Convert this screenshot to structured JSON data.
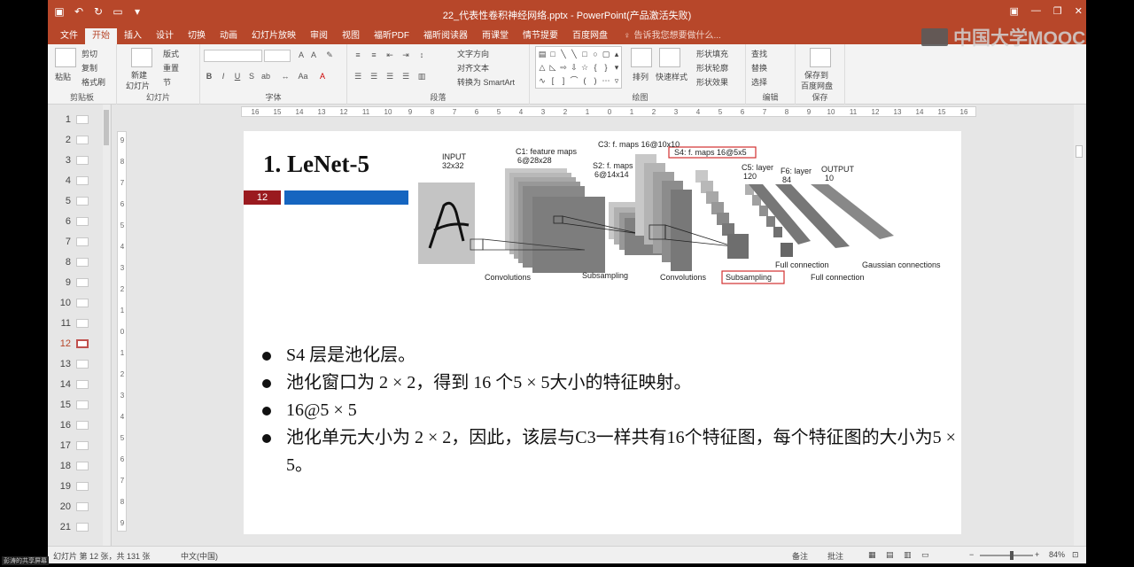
{
  "window": {
    "title": "22_代表性卷积神经网络.pptx - PowerPoint(产品激活失败)"
  },
  "tabs": [
    "文件",
    "开始",
    "插入",
    "设计",
    "切换",
    "动画",
    "幻灯片放映",
    "审阅",
    "视图",
    "福昕PDF",
    "福昕阅读器",
    "雨课堂",
    "情节提要",
    "百度网盘"
  ],
  "active_tab_index": 1,
  "tell_me": "告诉我您想要做什么...",
  "ribbon": {
    "groups": {
      "clipboard": "剪贴板",
      "slides": "幻灯片",
      "font": "字体",
      "paragraph": "段落",
      "drawing": "绘图",
      "editing": "编辑",
      "save": "保存"
    },
    "clipboard": {
      "paste": "粘贴",
      "cut": "剪切",
      "copy": "复制",
      "format_painter": "格式刷"
    },
    "slides": {
      "new_slide": "新建",
      "new_slide_2": "幻灯片",
      "layout": "版式",
      "reset": "重置",
      "section": "节"
    },
    "paragraph": {
      "text_direction": "文字方向",
      "align_text": "对齐文本",
      "smartart": "转换为 SmartArt"
    },
    "drawing": {
      "arrange": "排列",
      "quick_styles": "快速样式",
      "shape_fill": "形状填充",
      "shape_outline": "形状轮廓",
      "shape_effects": "形状效果"
    },
    "editing": {
      "find": "查找",
      "replace": "替换",
      "select": "选择"
    },
    "save": {
      "label1": "保存到",
      "label2": "百度网盘"
    }
  },
  "thumbnails": [
    "1",
    "2",
    "3",
    "4",
    "5",
    "6",
    "7",
    "8",
    "9",
    "10",
    "11",
    "12",
    "13",
    "14",
    "15",
    "16",
    "17",
    "18",
    "19",
    "20",
    "21"
  ],
  "active_thumbnail": "12",
  "hruler_ticks": [
    "16",
    "15",
    "14",
    "13",
    "12",
    "11",
    "10",
    "9",
    "8",
    "7",
    "6",
    "5",
    "4",
    "3",
    "2",
    "1",
    "0",
    "1",
    "2",
    "3",
    "4",
    "5",
    "6",
    "7",
    "8",
    "9",
    "10",
    "11",
    "12",
    "13",
    "14",
    "15",
    "16"
  ],
  "vruler_ticks": [
    "9",
    "8",
    "7",
    "6",
    "5",
    "4",
    "3",
    "2",
    "1",
    "0",
    "1",
    "2",
    "3",
    "4",
    "5",
    "6",
    "7",
    "8",
    "9"
  ],
  "slide": {
    "title": "1.   LeNet-5",
    "badge": "12",
    "diagram": {
      "input_label": "INPUT",
      "input_size": "32x32",
      "c1_label": "C1: feature maps",
      "c1_size": "6@28x28",
      "s2_label": "S2: f. maps",
      "s2_size": "6@14x14",
      "c3_label": "C3: f. maps 16@10x10",
      "s4_label": "S4: f. maps 16@5x5",
      "c5_label": "C5: layer",
      "c5_size": "120",
      "f6_label": "F6: layer",
      "f6_size": "84",
      "out_label": "OUTPUT",
      "out_size": "10",
      "bottom": {
        "conv1": "Convolutions",
        "sub1": "Subsampling",
        "conv2": "Convolutions",
        "sub2": "Subsampling",
        "full1": "Full connection",
        "full2": "Full connection",
        "gauss": "Gaussian connections"
      }
    },
    "bullets": [
      "S4 层是池化层。",
      "池化窗口为 2 × 2，得到 16 个5 × 5大小的特征映射。",
      "16@5 × 5",
      "池化单元大小为 2 × 2，因此，该层与C3一样共有16个特征图，每个特征图的大小为5 × 5。"
    ]
  },
  "status": {
    "slide_info": "幻灯片 第 12 张，共 131 张",
    "language": "中文(中国)",
    "notes": "备注",
    "comments": "批注",
    "zoom": "84%"
  },
  "watermark": "中国大学MOOC",
  "share_label": "彭涛的共享屏幕",
  "colors": {
    "accent": "#b7472a",
    "badge": "#9a1a1f",
    "bar": "#1565c0",
    "highlight_box": "#d32f2f"
  }
}
